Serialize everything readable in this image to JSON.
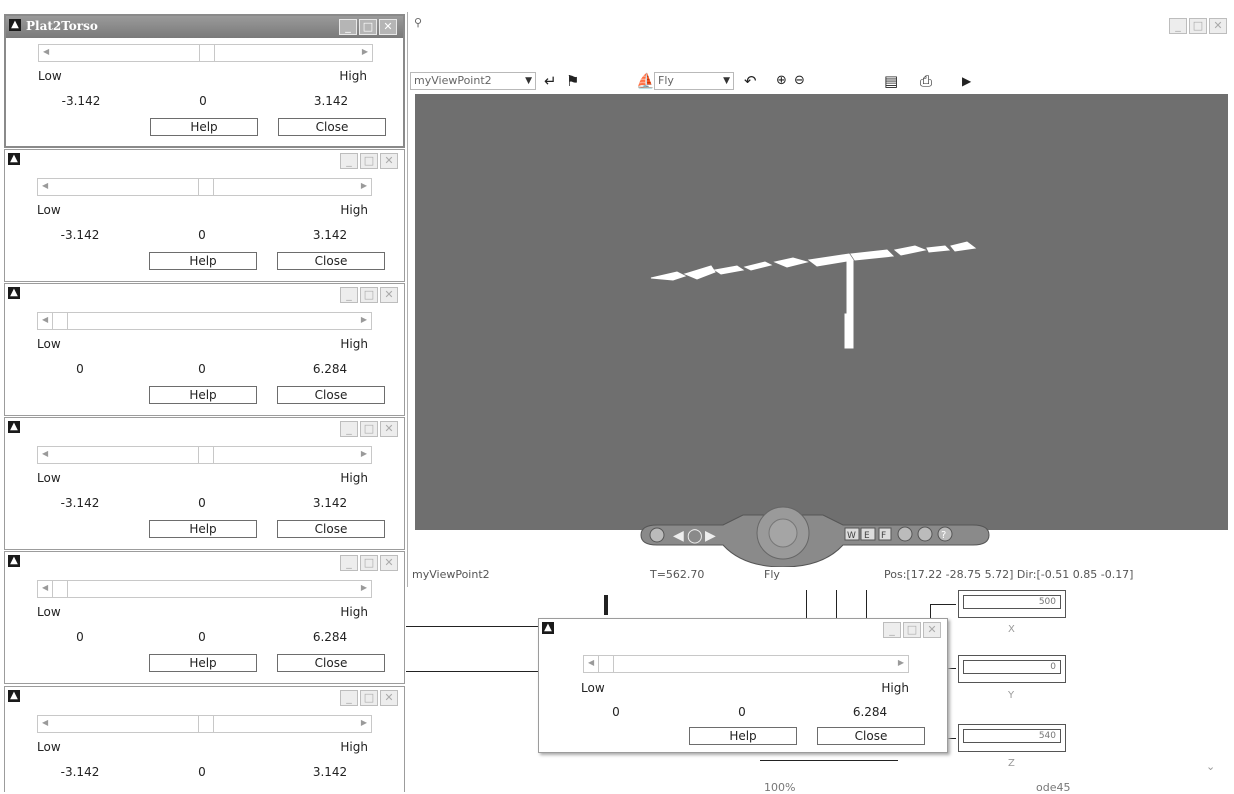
{
  "panels": [
    {
      "title": "Plat2Torso",
      "low": "Low",
      "high": "High",
      "min": "-3.142",
      "mid": "0",
      "max": "3.142",
      "help": "Help",
      "close": "Close",
      "thumb": 0.5
    },
    {
      "title": "",
      "low": "Low",
      "high": "High",
      "min": "-3.142",
      "mid": "0",
      "max": "3.142",
      "help": "Help",
      "close": "Close",
      "thumb": 0.5
    },
    {
      "title": "",
      "low": "Low",
      "high": "High",
      "min": "0",
      "mid": "0",
      "max": "6.284",
      "help": "Help",
      "close": "Close",
      "thumb": 0.0
    },
    {
      "title": "",
      "low": "Low",
      "high": "High",
      "min": "-3.142",
      "mid": "0",
      "max": "3.142",
      "help": "Help",
      "close": "Close",
      "thumb": 0.5
    },
    {
      "title": "",
      "low": "Low",
      "high": "High",
      "min": "0",
      "mid": "0",
      "max": "6.284",
      "help": "Help",
      "close": "Close",
      "thumb": 0.0
    },
    {
      "title": "",
      "low": "Low",
      "high": "High",
      "min": "-3.142",
      "mid": "0",
      "max": "3.142",
      "help": "Help",
      "close": "Close",
      "thumb": 0.5
    }
  ],
  "floating_panel": {
    "low": "Low",
    "high": "High",
    "min": "0",
    "mid": "0",
    "max": "6.284",
    "help": "Help",
    "close": "Close",
    "thumb": 0.0
  },
  "viewer": {
    "viewpoint": "myViewPoint2",
    "nav_mode": "Fly",
    "status_viewpoint": "myViewPoint2",
    "status_time": "T=562.70",
    "status_mode": "Fly",
    "status_pos": "Pos:[17.22 -28.75 5.72] Dir:[-0.51 0.85 -0.17]",
    "nav_letters": [
      "W",
      "E",
      "F"
    ]
  },
  "simulink": {
    "x_value": "500",
    "x_label": "X",
    "y_value": "0",
    "y_label": "Y",
    "z_value": "540",
    "z_label": "Z",
    "zoom": "100%",
    "solver": "ode45"
  }
}
